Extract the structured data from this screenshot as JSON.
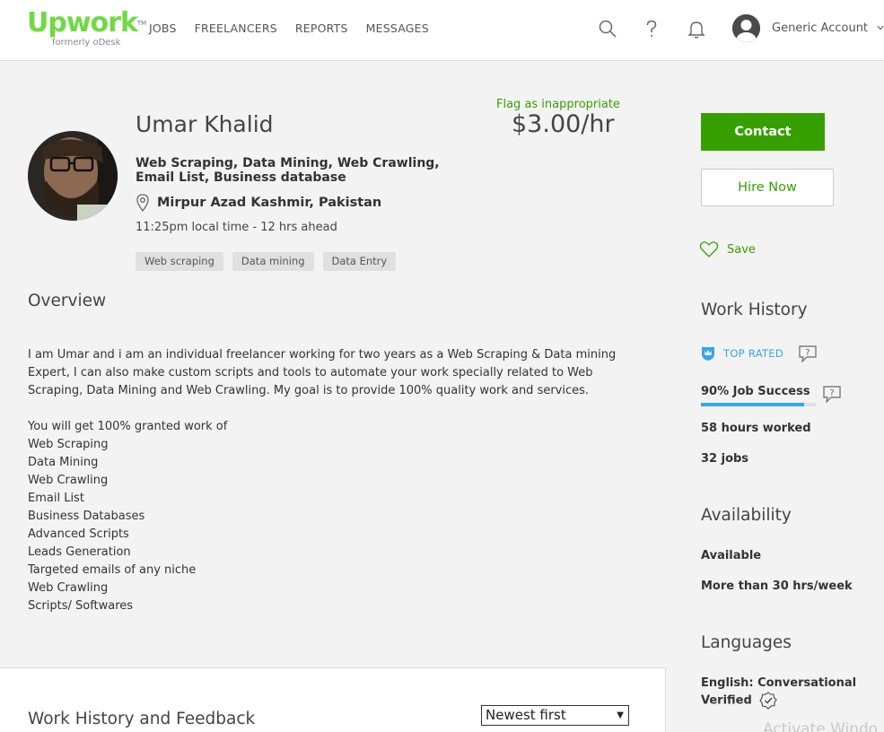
{
  "header": {
    "logo": "Upwork",
    "logo_tm": "TM",
    "logo_sub": "formerly oDesk",
    "nav": [
      "JOBS",
      "FREELANCERS",
      "REPORTS",
      "MESSAGES"
    ],
    "icons": [
      "search-icon",
      "help-icon",
      "bell-icon"
    ],
    "account_name": "Generic Account"
  },
  "profile": {
    "flag": "Flag as inappropriate",
    "name": "Umar Khalid",
    "rate": "$3.00/hr",
    "title": "Web Scraping, Data Mining, Web Crawling, Email List, Business database",
    "location": "Mirpur Azad Kashmir, Pakistan",
    "local_time": "11:25pm local time - 12 hrs ahead",
    "tags": [
      "Web scraping",
      "Data mining",
      "Data Entry"
    ]
  },
  "overview": {
    "heading": "Overview",
    "paragraph": "I am Umar and i am an individual freelancer working for two years as a Web Scraping & Data mining Expert, I can also make custom scripts and tools to automate your work specially related to Web Scraping, Data Mining and Web Crawling. My goal is to provide 100% quality work and services.",
    "list_intro": "You will get 100% granted work of",
    "list": [
      "Web Scraping",
      "Data Mining",
      "Web Crawling",
      "Email List",
      "Business Databases",
      "Advanced Scripts",
      "Leads Generation",
      "Targeted emails of any niche",
      "Web Crawling",
      "Scripts/ Softwares"
    ]
  },
  "sidebar": {
    "contact": "Contact",
    "hire": "Hire Now",
    "save": "Save",
    "work_history": {
      "heading": "Work History",
      "badge": "TOP RATED",
      "job_success": "90% Job Success",
      "job_success_value": 0.9,
      "hours": "58 hours worked",
      "jobs": "32 jobs"
    },
    "availability": {
      "heading": "Availability",
      "status": "Available",
      "hours": "More than 30 hrs/week"
    },
    "languages": {
      "heading": "Languages",
      "entry_line1": "English: Conversational",
      "entry_line2": "Verified"
    }
  },
  "feedback": {
    "heading": "Work History and Feedback",
    "sort": "Newest first"
  },
  "watermark": "Activate Windo",
  "colors": {
    "brand_green": "#37a000",
    "logo_green": "#6fda44",
    "top_rated_blue": "#37a6e8"
  }
}
